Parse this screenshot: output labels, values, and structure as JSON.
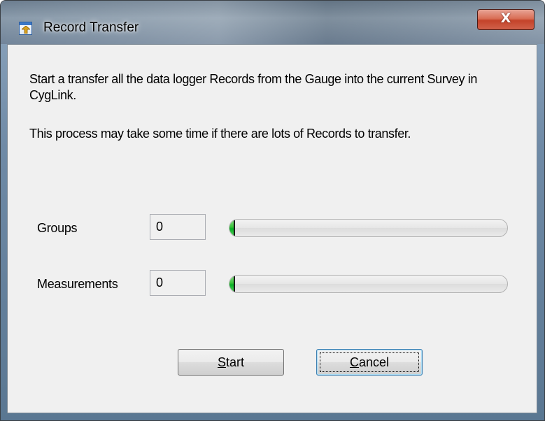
{
  "window": {
    "title": "Record Transfer",
    "app_icon": "app-window-icon",
    "close_label": "X",
    "close_icon": "close-icon"
  },
  "content": {
    "description": "Start a transfer all the data logger Records from the Gauge into the current Survey in CygLink.",
    "note": "This process may take some time if there are lots of Records to transfer."
  },
  "progress": {
    "groups": {
      "label": "Groups",
      "value": "0",
      "fraction": 0
    },
    "measurements": {
      "label": "Measurements",
      "value": "0",
      "fraction": 0
    },
    "bar_color": "#06b025"
  },
  "buttons": {
    "start": {
      "label": "Start",
      "mnemonic": "S",
      "rest": "tart"
    },
    "cancel": {
      "label": "Cancel",
      "mnemonic": "C",
      "rest": "ancel"
    }
  },
  "colors": {
    "close_button": "#c4432a",
    "dialog_background": "#f0f0f0"
  }
}
